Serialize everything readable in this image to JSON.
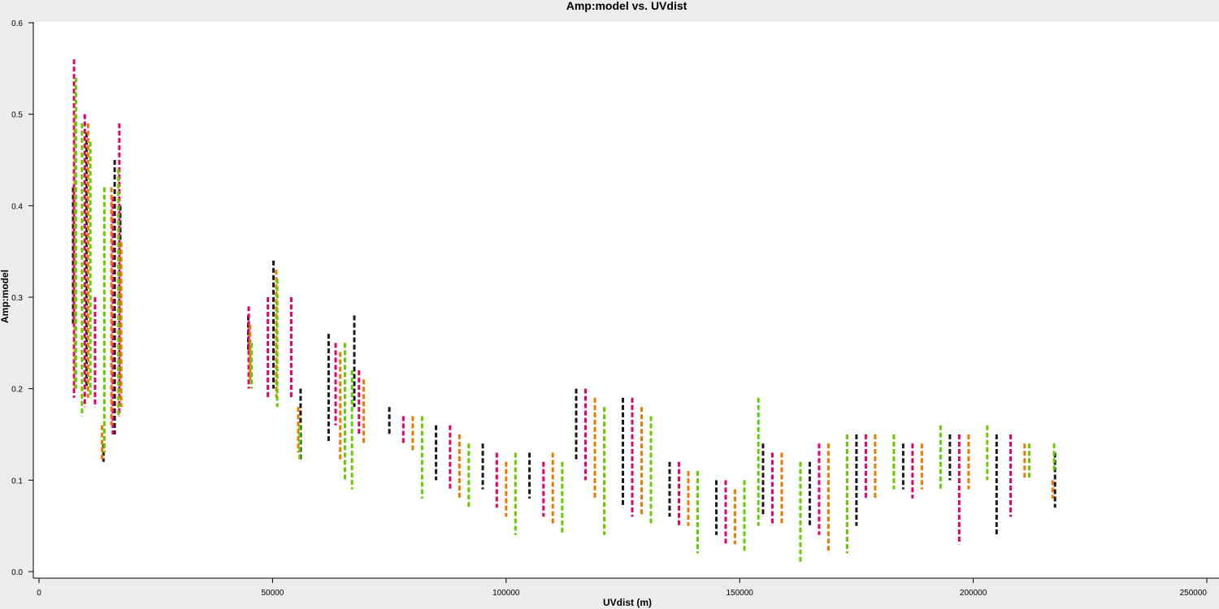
{
  "chart_data": {
    "type": "scatter",
    "title": "Amp:model vs. UVdist",
    "xlabel": "UVdist (m)",
    "ylabel": "Amp:model",
    "xlim": [
      0,
      250000
    ],
    "ylim": [
      0,
      0.6
    ],
    "x_ticks": [
      0,
      50000,
      100000,
      150000,
      200000,
      250000
    ],
    "x_tick_labels": [
      "0",
      "50000",
      "100000",
      "150000",
      "200000",
      "250000"
    ],
    "y_ticks": [
      0.0,
      0.1,
      0.2,
      0.3,
      0.4,
      0.5,
      0.6
    ],
    "y_tick_labels": [
      "0.0",
      "0.1",
      "0.2",
      "0.3",
      "0.4",
      "0.5",
      "0.6"
    ],
    "grid": false,
    "colors": [
      "#1a1a1a",
      "#e8006a",
      "#f07800",
      "#66cc00"
    ],
    "series": [
      {
        "color": "#1a1a1a",
        "values": [
          [
            7300,
            0.42
          ],
          [
            7300,
            0.27
          ],
          [
            10200,
            0.48
          ],
          [
            10200,
            0.2
          ],
          [
            13800,
            0.14
          ],
          [
            13800,
            0.12
          ],
          [
            16200,
            0.45
          ],
          [
            16200,
            0.15
          ],
          [
            17400,
            0.4
          ],
          [
            17400,
            0.2
          ],
          [
            44800,
            0.28
          ],
          [
            44800,
            0.24
          ],
          [
            50200,
            0.34
          ],
          [
            50200,
            0.2
          ],
          [
            56000,
            0.2
          ],
          [
            56000,
            0.12
          ],
          [
            62000,
            0.26
          ],
          [
            62000,
            0.14
          ],
          [
            67500,
            0.28
          ],
          [
            67500,
            0.18
          ],
          [
            75000,
            0.18
          ],
          [
            75000,
            0.15
          ],
          [
            85000,
            0.16
          ],
          [
            85000,
            0.1
          ],
          [
            95000,
            0.14
          ],
          [
            95000,
            0.09
          ],
          [
            105000,
            0.13
          ],
          [
            105000,
            0.08
          ],
          [
            115000,
            0.2
          ],
          [
            115000,
            0.12
          ],
          [
            125000,
            0.19
          ],
          [
            125000,
            0.07
          ],
          [
            135000,
            0.12
          ],
          [
            135000,
            0.06
          ],
          [
            145000,
            0.1
          ],
          [
            145000,
            0.04
          ],
          [
            155000,
            0.14
          ],
          [
            155000,
            0.06
          ],
          [
            165000,
            0.12
          ],
          [
            165000,
            0.05
          ],
          [
            175000,
            0.15
          ],
          [
            175000,
            0.05
          ],
          [
            185000,
            0.14
          ],
          [
            185000,
            0.09
          ],
          [
            195000,
            0.15
          ],
          [
            195000,
            0.1
          ],
          [
            205000,
            0.15
          ],
          [
            205000,
            0.04
          ],
          [
            217500,
            0.13
          ],
          [
            217500,
            0.07
          ]
        ]
      },
      {
        "color": "#e8006a",
        "values": [
          [
            7500,
            0.56
          ],
          [
            7500,
            0.19
          ],
          [
            9800,
            0.5
          ],
          [
            9800,
            0.18
          ],
          [
            12000,
            0.3
          ],
          [
            12000,
            0.18
          ],
          [
            15800,
            0.41
          ],
          [
            15800,
            0.15
          ],
          [
            17200,
            0.49
          ],
          [
            17200,
            0.17
          ],
          [
            44900,
            0.29
          ],
          [
            44900,
            0.2
          ],
          [
            49000,
            0.3
          ],
          [
            49000,
            0.19
          ],
          [
            54000,
            0.3
          ],
          [
            54000,
            0.19
          ],
          [
            63500,
            0.25
          ],
          [
            63500,
            0.16
          ],
          [
            68500,
            0.22
          ],
          [
            68500,
            0.15
          ],
          [
            78000,
            0.17
          ],
          [
            78000,
            0.14
          ],
          [
            88000,
            0.16
          ],
          [
            88000,
            0.09
          ],
          [
            98000,
            0.13
          ],
          [
            98000,
            0.07
          ],
          [
            108000,
            0.12
          ],
          [
            108000,
            0.06
          ],
          [
            117000,
            0.2
          ],
          [
            117000,
            0.1
          ],
          [
            127000,
            0.19
          ],
          [
            127000,
            0.06
          ],
          [
            137000,
            0.12
          ],
          [
            137000,
            0.05
          ],
          [
            147000,
            0.1
          ],
          [
            147000,
            0.03
          ],
          [
            157000,
            0.13
          ],
          [
            157000,
            0.05
          ],
          [
            167000,
            0.14
          ],
          [
            167000,
            0.04
          ],
          [
            177000,
            0.15
          ],
          [
            177000,
            0.08
          ],
          [
            187000,
            0.14
          ],
          [
            187000,
            0.08
          ],
          [
            197000,
            0.15
          ],
          [
            197000,
            0.03
          ],
          [
            208000,
            0.15
          ],
          [
            208000,
            0.06
          ]
        ]
      },
      {
        "color": "#f07800",
        "values": [
          [
            7700,
            0.5
          ],
          [
            7700,
            0.2
          ],
          [
            10500,
            0.49
          ],
          [
            10500,
            0.19
          ],
          [
            13500,
            0.16
          ],
          [
            13500,
            0.12
          ],
          [
            15500,
            0.42
          ],
          [
            15500,
            0.16
          ],
          [
            17600,
            0.36
          ],
          [
            17600,
            0.18
          ],
          [
            45200,
            0.27
          ],
          [
            45200,
            0.21
          ],
          [
            50800,
            0.33
          ],
          [
            50800,
            0.19
          ],
          [
            55500,
            0.18
          ],
          [
            55500,
            0.13
          ],
          [
            64500,
            0.24
          ],
          [
            64500,
            0.12
          ],
          [
            69500,
            0.21
          ],
          [
            69500,
            0.14
          ],
          [
            80000,
            0.17
          ],
          [
            80000,
            0.13
          ],
          [
            90000,
            0.15
          ],
          [
            90000,
            0.08
          ],
          [
            100000,
            0.12
          ],
          [
            100000,
            0.06
          ],
          [
            110000,
            0.13
          ],
          [
            110000,
            0.05
          ],
          [
            119000,
            0.19
          ],
          [
            119000,
            0.08
          ],
          [
            129000,
            0.18
          ],
          [
            129000,
            0.06
          ],
          [
            139000,
            0.11
          ],
          [
            139000,
            0.05
          ],
          [
            149000,
            0.09
          ],
          [
            149000,
            0.03
          ],
          [
            159000,
            0.13
          ],
          [
            159000,
            0.05
          ],
          [
            169000,
            0.14
          ],
          [
            169000,
            0.02
          ],
          [
            179000,
            0.15
          ],
          [
            179000,
            0.08
          ],
          [
            189000,
            0.14
          ],
          [
            189000,
            0.09
          ],
          [
            199000,
            0.15
          ],
          [
            199000,
            0.09
          ],
          [
            211000,
            0.14
          ],
          [
            211000,
            0.1
          ],
          [
            217000,
            0.1
          ],
          [
            217000,
            0.08
          ]
        ]
      },
      {
        "color": "#66cc00",
        "values": [
          [
            7900,
            0.54
          ],
          [
            7900,
            0.2
          ],
          [
            9200,
            0.49
          ],
          [
            9200,
            0.17
          ],
          [
            11000,
            0.47
          ],
          [
            11000,
            0.19
          ],
          [
            14000,
            0.42
          ],
          [
            14000,
            0.13
          ],
          [
            17000,
            0.44
          ],
          [
            17000,
            0.17
          ],
          [
            45500,
            0.25
          ],
          [
            45500,
            0.2
          ],
          [
            51000,
            0.32
          ],
          [
            51000,
            0.18
          ],
          [
            55800,
            0.16
          ],
          [
            55800,
            0.12
          ],
          [
            65500,
            0.25
          ],
          [
            65500,
            0.1
          ],
          [
            67000,
            0.22
          ],
          [
            67000,
            0.09
          ],
          [
            82000,
            0.17
          ],
          [
            82000,
            0.08
          ],
          [
            92000,
            0.14
          ],
          [
            92000,
            0.07
          ],
          [
            102000,
            0.13
          ],
          [
            102000,
            0.04
          ],
          [
            112000,
            0.12
          ],
          [
            112000,
            0.04
          ],
          [
            121000,
            0.18
          ],
          [
            121000,
            0.04
          ],
          [
            131000,
            0.17
          ],
          [
            131000,
            0.05
          ],
          [
            141000,
            0.11
          ],
          [
            141000,
            0.02
          ],
          [
            151000,
            0.1
          ],
          [
            151000,
            0.02
          ],
          [
            154000,
            0.19
          ],
          [
            154000,
            0.05
          ],
          [
            163000,
            0.12
          ],
          [
            163000,
            0.01
          ],
          [
            173000,
            0.15
          ],
          [
            173000,
            0.02
          ],
          [
            183000,
            0.15
          ],
          [
            183000,
            0.09
          ],
          [
            193000,
            0.16
          ],
          [
            193000,
            0.09
          ],
          [
            203000,
            0.16
          ],
          [
            203000,
            0.1
          ],
          [
            212000,
            0.14
          ],
          [
            212000,
            0.1
          ],
          [
            217300,
            0.14
          ],
          [
            217300,
            0.11
          ]
        ]
      }
    ]
  }
}
